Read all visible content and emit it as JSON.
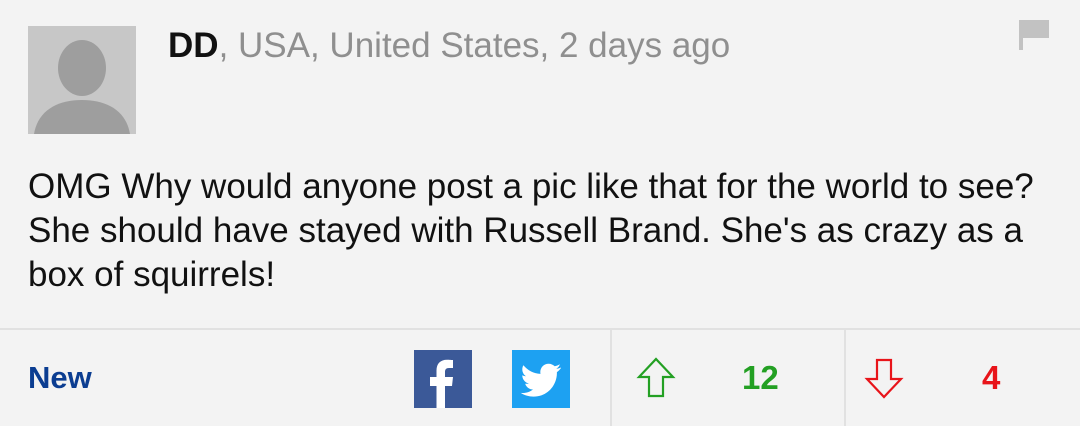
{
  "comment": {
    "author": "DD",
    "location_time": ", USA, United States, 2 days ago",
    "text": "OMG Why would anyone post a pic like that for the world to see? She should have stayed with Russell Brand. She's as crazy as a box of squirrels!",
    "avatar_icon": "default-avatar-icon",
    "flag_icon": "flag-icon"
  },
  "footer": {
    "new_label": "New",
    "share": [
      {
        "icon": "facebook-icon",
        "color": "#3b5998"
      },
      {
        "icon": "twitter-icon",
        "color": "#1da1f2"
      }
    ],
    "votes": {
      "up_icon": "up-arrow-icon",
      "up_count": "12",
      "up_color": "#23a023",
      "down_icon": "down-arrow-icon",
      "down_count": "4",
      "down_color": "#e8141a"
    }
  }
}
